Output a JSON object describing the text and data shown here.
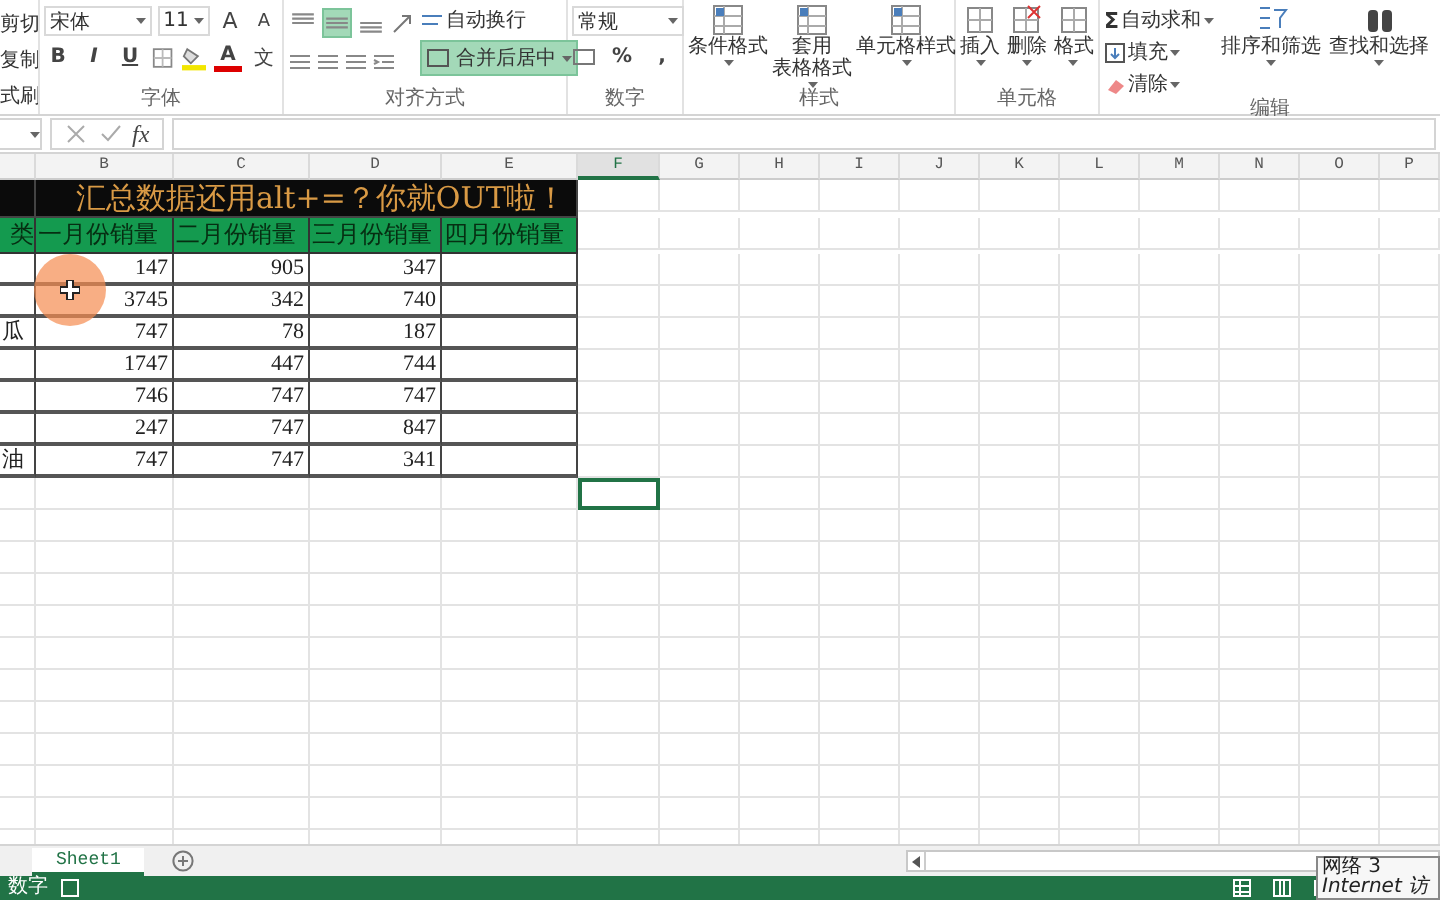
{
  "ribbon": {
    "clipboard": {
      "items": [
        "剪切",
        "复制",
        "式刷"
      ]
    },
    "font": {
      "label": "字体",
      "name": "宋体",
      "size": "11",
      "grow": "A",
      "shrink": "A",
      "styles": [
        "B",
        "I",
        "U"
      ],
      "font_color": "A",
      "phonetic": "文"
    },
    "alignment": {
      "label": "对齐方式",
      "vertical": [
        {
          "selected": false
        },
        {
          "selected": true
        },
        {
          "selected": false
        }
      ],
      "wrap_text": "自动换行",
      "merge": {
        "label": "合并后居中",
        "selected": true
      }
    },
    "number": {
      "label": "数字",
      "format": "常规",
      "symbols": [
        "%",
        ","
      ]
    },
    "styles": {
      "label": "样式",
      "buttons": [
        {
          "lines": [
            "条件格式"
          ]
        },
        {
          "lines": [
            "套用",
            "表格格式"
          ]
        },
        {
          "lines": [
            "单元格样式"
          ]
        }
      ]
    },
    "cells": {
      "label": "单元格",
      "buttons": [
        "插入",
        "删除",
        "格式"
      ]
    },
    "editing": {
      "label": "编辑",
      "sum_symbol": "Σ",
      "small": [
        "自动求和",
        "填充",
        "清除"
      ],
      "large": [
        "排序和筛选",
        "查找和选择"
      ]
    }
  },
  "formula_bar": {
    "function_label": "fx"
  },
  "sheet": {
    "columns": [
      {
        "label": "B",
        "selected": false
      },
      {
        "label": "C",
        "selected": false
      },
      {
        "label": "D",
        "selected": false
      },
      {
        "label": "E",
        "selected": false
      },
      {
        "label": "F",
        "selected": true
      },
      {
        "label": "G",
        "selected": false
      },
      {
        "label": "H",
        "selected": false
      },
      {
        "label": "I",
        "selected": false
      },
      {
        "label": "J",
        "selected": false
      },
      {
        "label": "K",
        "selected": false
      },
      {
        "label": "L",
        "selected": false
      },
      {
        "label": "M",
        "selected": false
      },
      {
        "label": "N",
        "selected": false
      },
      {
        "label": "O",
        "selected": false
      },
      {
        "label": "P",
        "selected": false
      }
    ],
    "title": "汇总数据还用alt+=？你就OUT啦！",
    "header_a": "类",
    "headers": [
      "一月份销量",
      "二月份销量",
      "三月份销量",
      "四月份销量"
    ],
    "rows": [
      {
        "values": [
          "147",
          "905",
          "347"
        ]
      },
      {
        "values": [
          "3745",
          "342",
          "740"
        ]
      },
      {
        "label": "瓜",
        "values": [
          "747",
          "78",
          "187"
        ]
      },
      {
        "values": [
          "1747",
          "447",
          "744"
        ]
      },
      {
        "values": [
          "746",
          "747",
          "747"
        ]
      },
      {
        "values": [
          "247",
          "747",
          "847"
        ]
      },
      {
        "label": "油",
        "values": [
          "747",
          "747",
          "341"
        ]
      }
    ]
  },
  "sheet_tabs": [
    {
      "label": "Sheet1",
      "selected": true
    }
  ],
  "status_bar": {
    "mode": "数字"
  },
  "tooltip": {
    "lines": [
      "网络 3",
      "Internet 访"
    ]
  }
}
